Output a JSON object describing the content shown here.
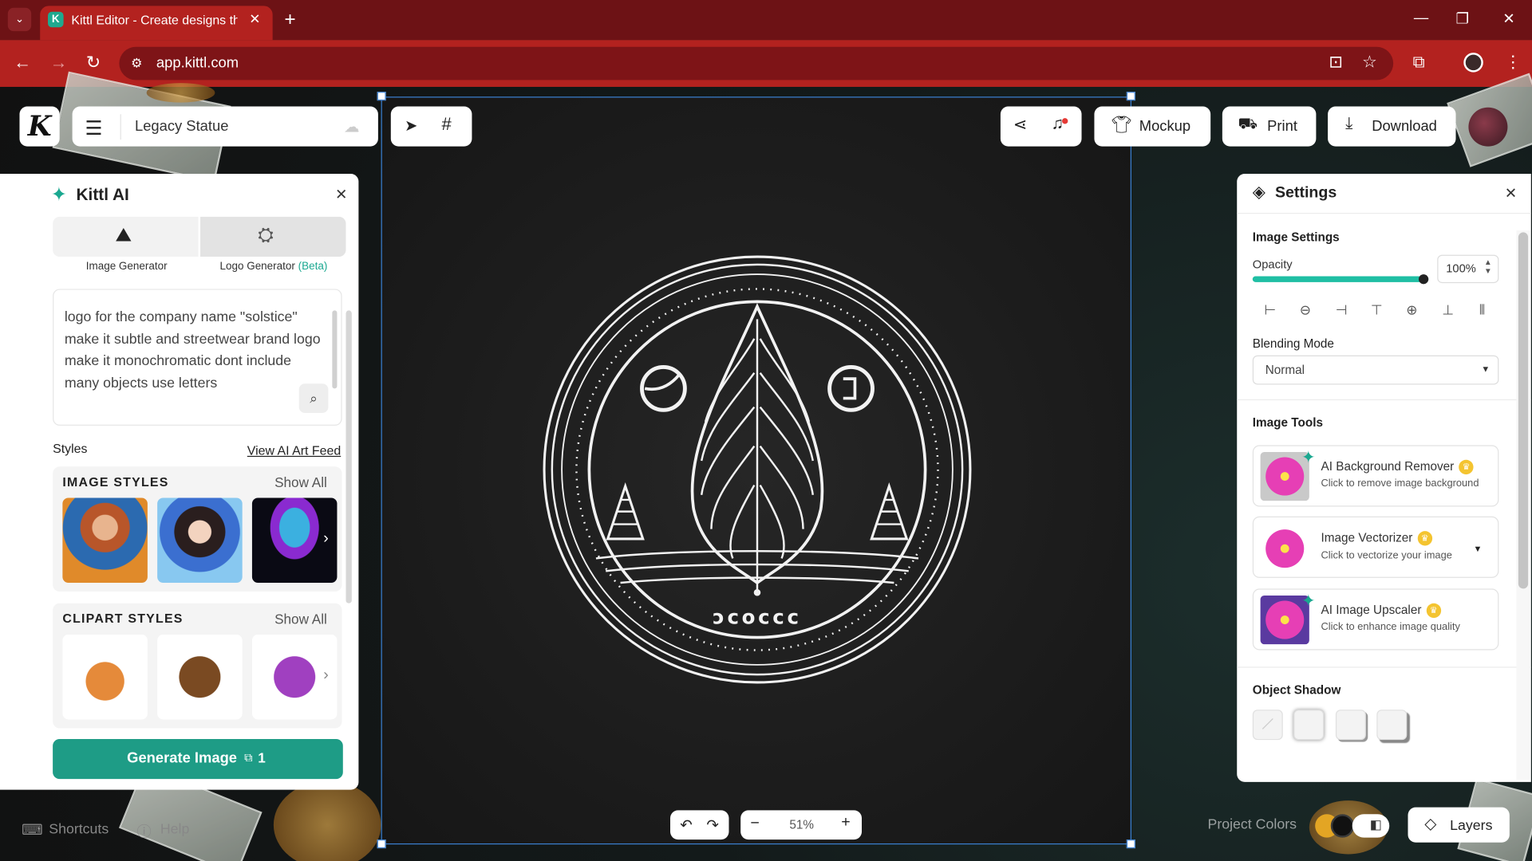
{
  "browser": {
    "tab_title": "Kittl Editor - Create designs that",
    "favicon_letter": "K",
    "url": "app.kittl.com"
  },
  "header": {
    "logo_letter": "K",
    "project_name": "Legacy Statue",
    "mockup_label": "Mockup",
    "print_label": "Print",
    "download_label": "Download"
  },
  "ai_panel": {
    "title": "Kittl AI",
    "tabs": [
      {
        "label": "Image Generator"
      },
      {
        "label": "Logo Generator",
        "badge": "(Beta)"
      }
    ],
    "prompt": "logo for the company name \"solstice\" make it subtle and streetwear brand logo make it monochromatic dont include many objects use letters",
    "styles_label": "Styles",
    "feed_link": "View AI Art Feed",
    "image_styles": {
      "title": "IMAGE STYLES",
      "show_all": "Show All"
    },
    "clipart_styles": {
      "title": "CLIPART STYLES",
      "show_all": "Show All"
    },
    "generate_label": "Generate Image",
    "credits": "1"
  },
  "settings": {
    "title": "Settings",
    "image_settings": "Image Settings",
    "opacity_label": "Opacity",
    "opacity_value": "100%",
    "opacity_fraction": 1.0,
    "blending_label": "Blending Mode",
    "blending_value": "Normal",
    "tools_label": "Image Tools",
    "tools": [
      {
        "name": "AI Background Remover",
        "desc": "Click to remove image background"
      },
      {
        "name": "Image Vectorizer",
        "desc": "Click to vectorize your image"
      },
      {
        "name": "AI Image Upscaler",
        "desc": "Click to enhance image quality"
      }
    ],
    "shadow_label": "Object Shadow"
  },
  "bottom": {
    "shortcuts": "Shortcuts",
    "help": "Help",
    "zoom": "51%",
    "project_colors": "Project Colors",
    "layers": "Layers"
  },
  "artwork": {
    "wordmark": "ɔcoccc"
  }
}
